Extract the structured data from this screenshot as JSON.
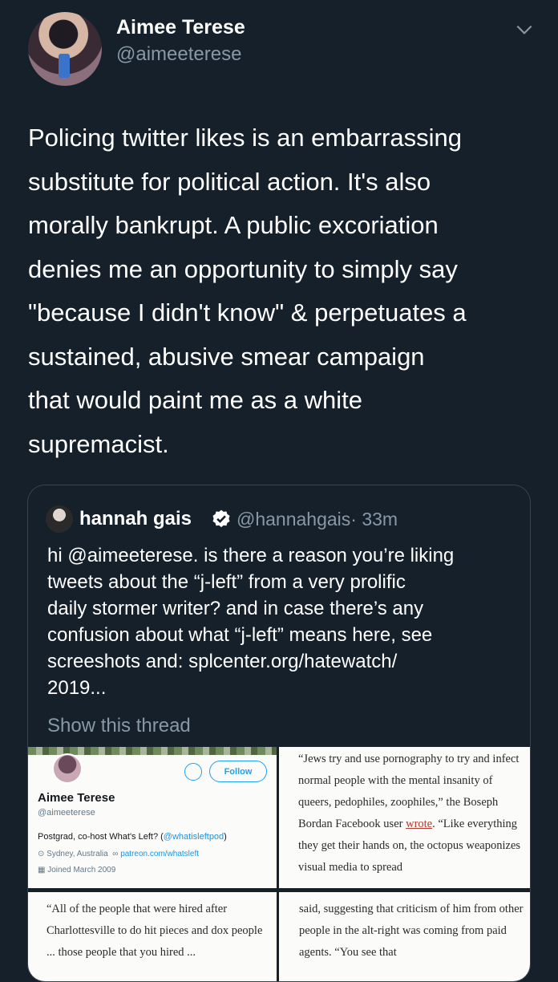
{
  "tweet": {
    "author_name": "Aimee Terese",
    "author_handle": "@aimeeterese",
    "text": "Policing twitter likes is an embarrassing\nsubstitute for political action. It's also\nmorally bankrupt. A public excoriation\ndenies me an opportunity to simply say\n\"because I didn't know\" & perpetuates a\nsustained, abusive smear campaign\nthat would paint me as a white\nsupremacist."
  },
  "quoted": {
    "author_name": "hannah gais",
    "author_handle": "@hannahgais",
    "time": "· 33m",
    "text": "hi @aimeeterese. is there a reason you’re liking\ntweets about the “j-left” from a very prolific\ndaily stormer writer? and in case there’s any\nconfusion about what “j-left” means here, see\nscreeshots and: splcenter.org/hatewatch/\n2019...",
    "show_thread": "Show this thread"
  },
  "images": {
    "profile": {
      "follow_label": "Follow",
      "name": "Aimee Terese",
      "handle": "@aimeeterese",
      "bio_prefix": "Postgrad, co-host What's Left? (",
      "bio_link": "@whatisleftpod",
      "bio_suffix": ")",
      "location": "Sydney, Australia",
      "website": "patreon.com/whatsleft",
      "joined": "Joined March 2009"
    },
    "article_top_right": {
      "text_before": "“Jews try and use pornography to try and infect normal people with the mental insanity of queers, pedophiles, zoophiles,” the Boseph Bordan Facebook user ",
      "link": "wrote",
      "text_after": ". “Like everything they get their hands on, the octopus weaponizes visual media to spread"
    },
    "article_bottom_left": "“All of the people that were hired after Charlottesville to do hit pieces and dox people ... those people that you hired ...",
    "article_bottom_right": "said, suggesting that criticism of him from other people in the alt-right was coming from paid agents. “You see that"
  },
  "icons": {
    "menu": "chevron-down-icon",
    "verified": "verified-badge-icon",
    "message": "envelope-icon",
    "location": "location-pin-icon",
    "website": "link-icon",
    "joined": "calendar-icon"
  },
  "colors": {
    "background": "#15202b",
    "secondary_text": "#8899a6",
    "border": "#38444d",
    "link_blue": "#1da1f2"
  }
}
